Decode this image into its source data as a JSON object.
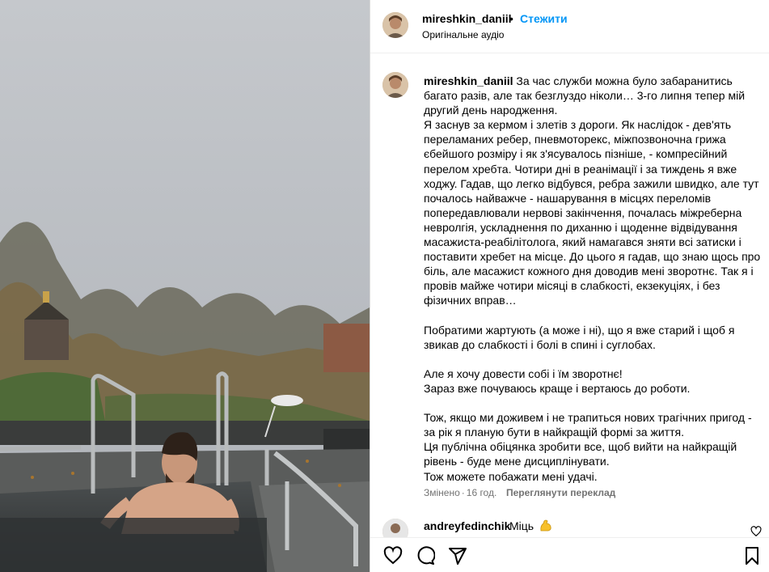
{
  "post": {
    "username": "mireshkin_daniil",
    "separator": "•",
    "follow_label": "Стежити",
    "audio_label": "Оригінальне аудіо"
  },
  "caption": {
    "username": "mireshkin_daniil",
    "text": "За час служби можна було забаранитись багато разів, але так безглуздо ніколи… 3-го липня тепер мій другий день народження.\nЯ заснув за кермом і злетів з дороги. Як наслідок - дев'ять переламаних ребер, пневмоторекс, міжпозвоночна грижа єбейшого розміру і як з'ясувалось пізніше, - компресійний перелом хребта. Чотири дні в реанімації і за тиждень я вже ходжу. Гадав, що легко відбувся, ребра зажили швидко, але тут почалось найважче - нашарування в місцях переломів попередавлювали нервові закінчення, почалась міжреберна невролгія, ускладнення по диханню і щоденне відвідування масажиста-реабілітолога, який намагався зняти всі затиски і поставити хребет на місце. До цього я гадав, що знаю щось про біль, але масажист кожного дня доводив мені зворотнє. Так я і провів майже чотири місяці в слабкості, екзекуціях, і без фізичних вправ…\n\nПобратими жартують (а може і ні), що я вже старий і щоб я звикав до слабкості і болі в спині і суглобах.\n\nАле я хочу довести собі і їм зворотнє!\nЗараз вже почуваюсь краще і вертаюсь до роботи.\n\nТож, якщо ми доживем і не трапиться нових трагічних пригод - за рік я планую бути в найкращій формі за життя.\nЦя публічна обіцянка зробити все, щоб вийти на найкращій рівень - буде мене дисциплінувати.\nТож можете побажати мені удачі.",
    "edited_label": "Змінено",
    "separator": "·",
    "time_ago": "16 год.",
    "translate_label": "Переглянути переклад"
  },
  "comment": {
    "username": "andreyfedinchik",
    "text": "Міць",
    "emoji_icon": "flexed-biceps-icon"
  },
  "colors": {
    "link_blue": "#0095f6",
    "secondary_text": "#737373",
    "border": "#dbdbdb"
  },
  "icons": [
    "heart-icon",
    "comment-icon",
    "share-icon",
    "bookmark-icon"
  ]
}
